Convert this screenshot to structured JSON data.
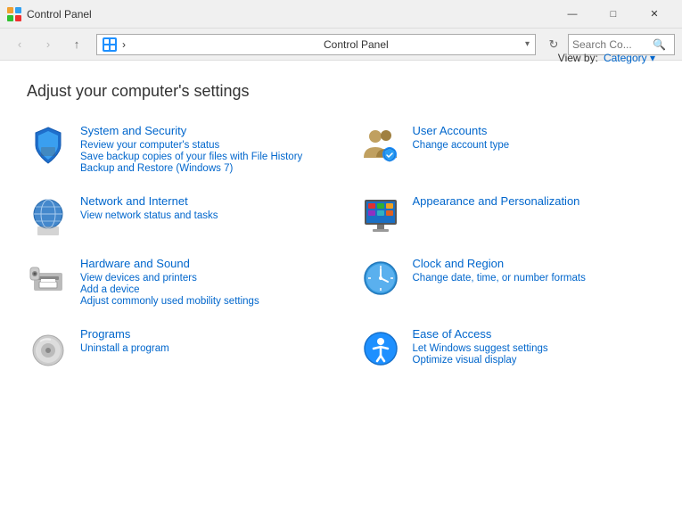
{
  "titlebar": {
    "title": "Control Panel",
    "min_label": "—",
    "max_label": "□",
    "close_label": "✕"
  },
  "navbar": {
    "back_btn": "‹",
    "forward_btn": "›",
    "up_btn": "↑",
    "address_icon": "⊞",
    "address_text": "Control Panel",
    "refresh": "↻",
    "search_placeholder": "Search Co...",
    "search_icon": "🔍"
  },
  "page": {
    "title": "Adjust your computer's settings",
    "view_by_label": "View by:",
    "view_by_value": "Category ▾"
  },
  "categories": [
    {
      "id": "system-security",
      "name": "System and Security",
      "links": [
        "Review your computer's status",
        "Save backup copies of your files with File History",
        "Backup and Restore (Windows 7)"
      ]
    },
    {
      "id": "user-accounts",
      "name": "User Accounts",
      "links": [
        "Change account type"
      ]
    },
    {
      "id": "network-internet",
      "name": "Network and Internet",
      "links": [
        "View network status and tasks"
      ]
    },
    {
      "id": "appearance",
      "name": "Appearance and Personalization",
      "links": []
    },
    {
      "id": "hardware-sound",
      "name": "Hardware and Sound",
      "links": [
        "View devices and printers",
        "Add a device",
        "Adjust commonly used mobility settings"
      ]
    },
    {
      "id": "clock-region",
      "name": "Clock and Region",
      "links": [
        "Change date, time, or number formats"
      ]
    },
    {
      "id": "programs",
      "name": "Programs",
      "links": [
        "Uninstall a program"
      ]
    },
    {
      "id": "ease-access",
      "name": "Ease of Access",
      "links": [
        "Let Windows suggest settings",
        "Optimize visual display"
      ]
    }
  ]
}
